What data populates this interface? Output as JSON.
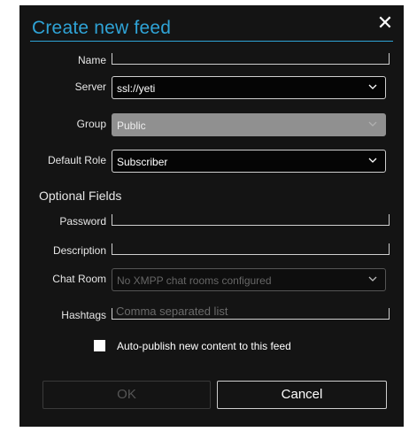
{
  "dialog": {
    "title": "Create new feed",
    "close_symbol": "✕"
  },
  "fields": {
    "name": {
      "label": "Name",
      "value": ""
    },
    "server": {
      "label": "Server",
      "value": "ssl://yeti"
    },
    "group": {
      "label": "Group",
      "value": "Public",
      "disabled": true
    },
    "default_role": {
      "label": "Default Role",
      "value": "Subscriber"
    }
  },
  "optional": {
    "heading": "Optional Fields",
    "password": {
      "label": "Password",
      "value": ""
    },
    "description": {
      "label": "Description",
      "value": ""
    },
    "chat_room": {
      "label": "Chat Room",
      "value": "No XMPP chat rooms configured",
      "disabled": true
    },
    "hashtags": {
      "label": "Hashtags",
      "placeholder": "Comma separated list"
    }
  },
  "auto_publish": {
    "label": "Auto-publish new content to this feed",
    "checked": false
  },
  "buttons": {
    "ok": "OK",
    "cancel": "Cancel",
    "ok_enabled": false
  },
  "colors": {
    "accent": "#2fa3d6",
    "background": "#141414",
    "disabled_select": "#909090"
  },
  "icons": {
    "close": "close-icon",
    "dropdown": "chevron-down-icon"
  }
}
